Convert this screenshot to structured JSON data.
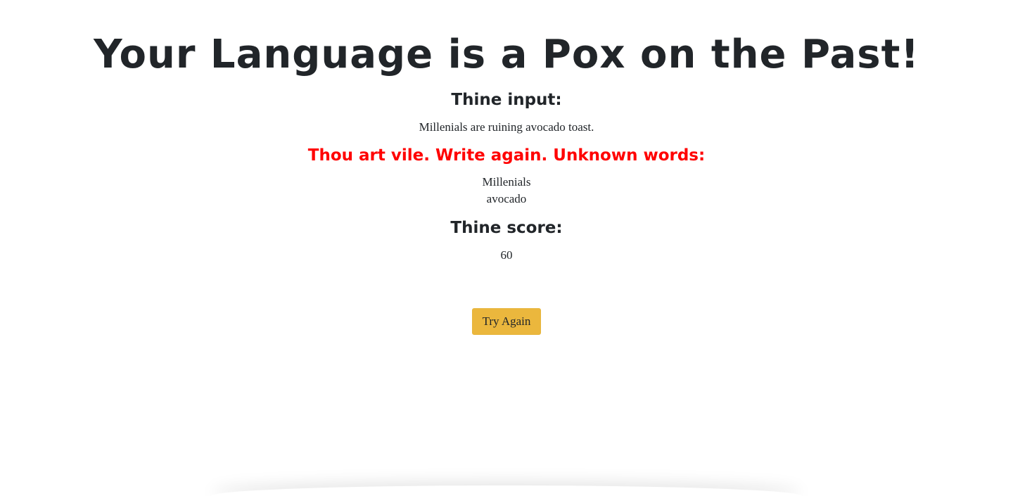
{
  "page": {
    "title": "Your Language is a Pox on the Past!"
  },
  "input_section": {
    "heading": "Thine input:",
    "text": "Millenials are ruining avocado toast."
  },
  "error_section": {
    "heading": "Thou art vile. Write again. Unknown words:",
    "color": "#ff0000",
    "unknown_words": [
      "Millenials",
      "avocado"
    ]
  },
  "score_section": {
    "heading": "Thine score:",
    "value": "60"
  },
  "actions": {
    "try_again_label": "Try Again",
    "button_color": "#ebb73d"
  }
}
